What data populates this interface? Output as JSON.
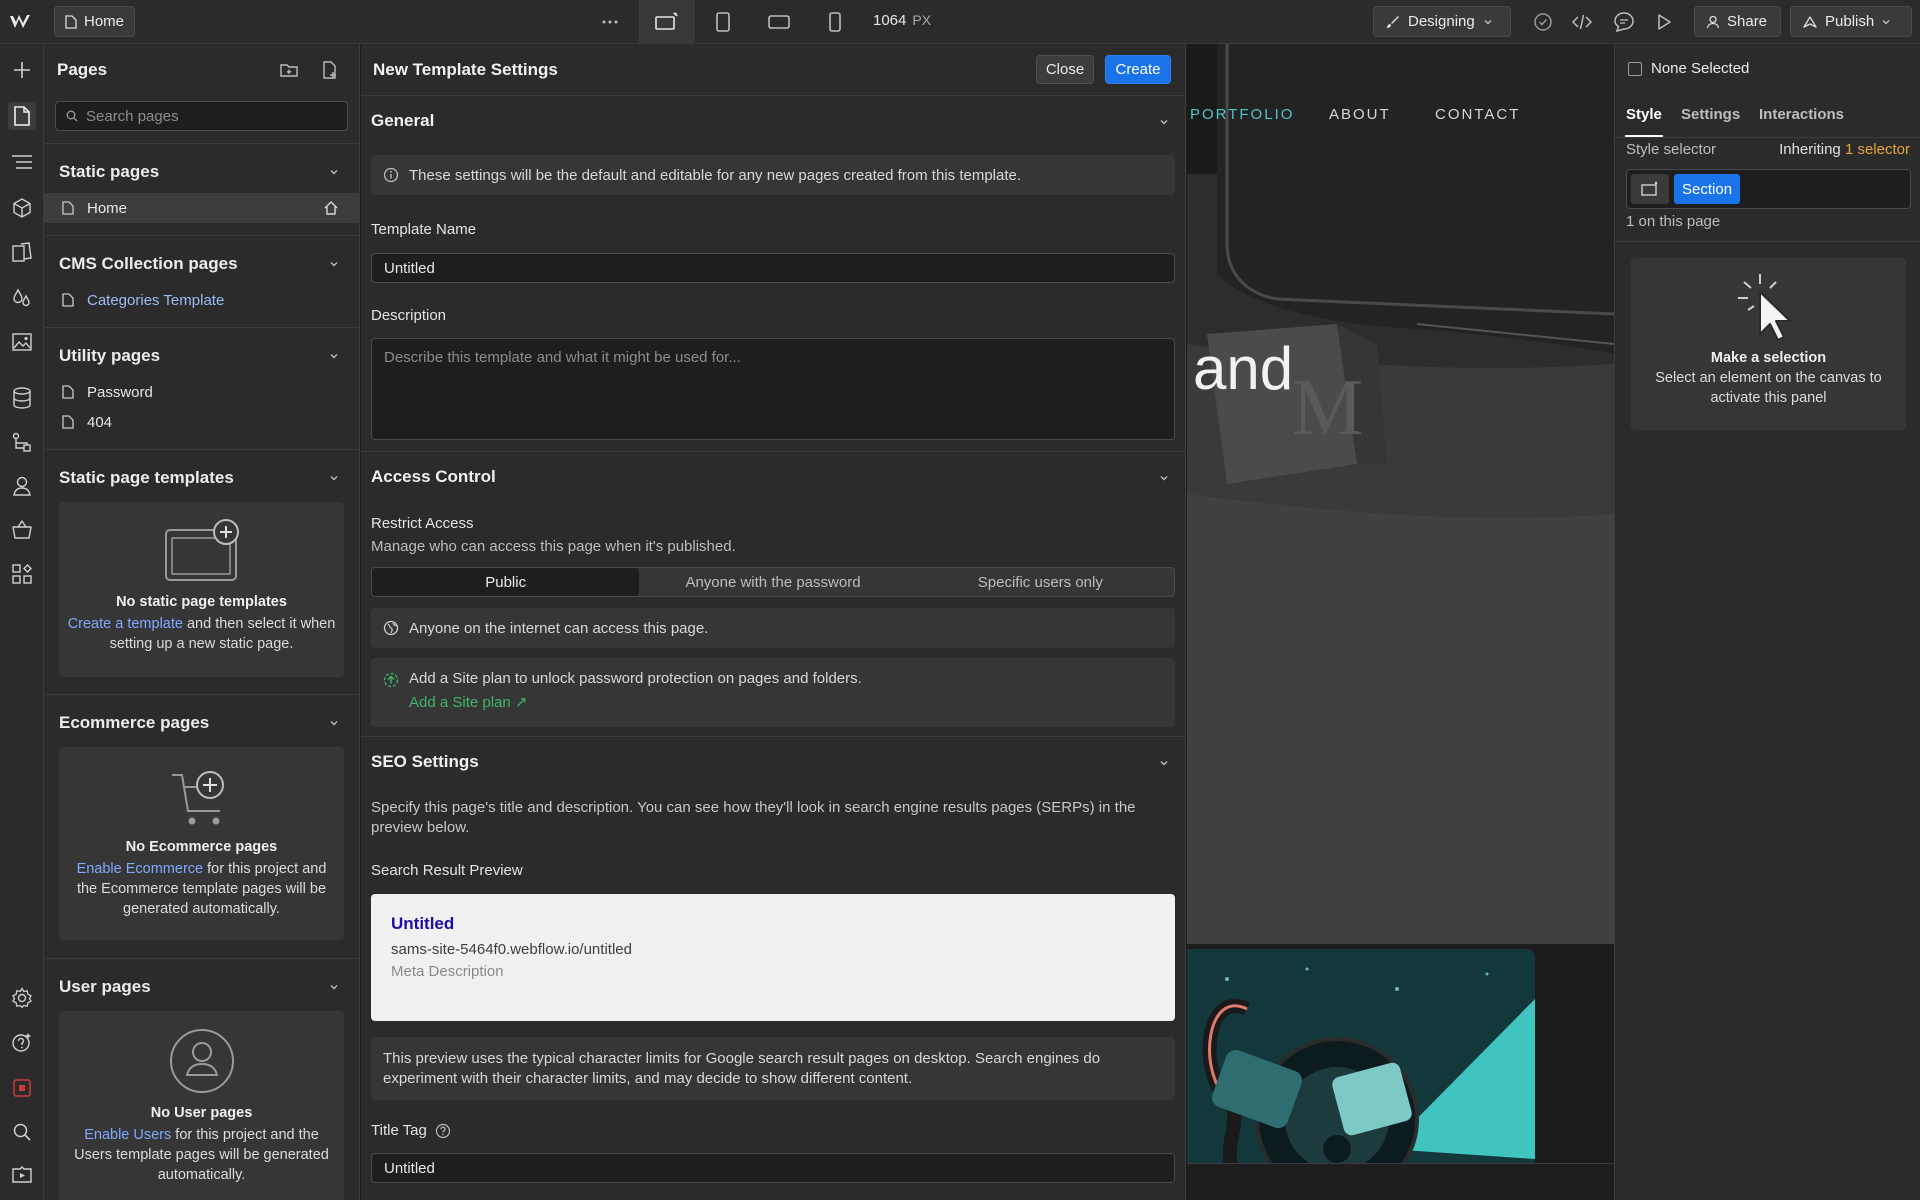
{
  "topbar": {
    "page_button": "Home",
    "width_value": "1064",
    "width_unit": "PX",
    "mode_label": "Designing",
    "share_label": "Share",
    "publish_label": "Publish"
  },
  "pages_panel": {
    "title": "Pages",
    "search_placeholder": "Search pages",
    "sections": {
      "static": {
        "title": "Static pages",
        "items": [
          "Home"
        ]
      },
      "cms": {
        "title": "CMS Collection pages",
        "items": [
          "Categories Template"
        ]
      },
      "utility": {
        "title": "Utility pages",
        "items": [
          "Password",
          "404"
        ]
      },
      "templates": {
        "title": "Static page templates",
        "empty_title": "No static page templates",
        "link": "Create a template",
        "text": " and then select it when setting up a new static page."
      },
      "ecommerce": {
        "title": "Ecommerce pages",
        "empty_title": "No Ecommerce pages",
        "link": "Enable Ecommerce",
        "text": " for this project and the Ecommerce template pages will be generated automatically."
      },
      "users": {
        "title": "User pages",
        "empty_title": "No User pages",
        "link": "Enable Users",
        "text": " for this project and the Users template pages will be generated automatically."
      }
    }
  },
  "template_settings": {
    "title": "New Template Settings",
    "close_label": "Close",
    "create_label": "Create",
    "general": {
      "title": "General",
      "info": "These settings will be the default and editable for any new pages created from this template.",
      "name_label": "Template Name",
      "name_value": "Untitled",
      "description_label": "Description",
      "description_placeholder": "Describe this template and what it might be used for..."
    },
    "access": {
      "title": "Access Control",
      "restrict_label": "Restrict Access",
      "restrict_sub": "Manage who can access this page when it's published.",
      "options": [
        "Public",
        "Anyone with the password",
        "Specific users only"
      ],
      "selected": "Public",
      "public_info": "Anyone on the internet can access this page.",
      "plan_info": "Add a Site plan to unlock password protection on pages and folders.",
      "plan_link": "Add a Site plan ↗"
    },
    "seo": {
      "title": "SEO Settings",
      "intro": "Specify this page's title and description. You can see how they'll look in search engine results pages (SERPs) in the preview below.",
      "preview_label": "Search Result Preview",
      "preview_title": "Untitled",
      "preview_url": "sams-site-5464f0.webflow.io/untitled",
      "preview_desc": "Meta Description",
      "note": "This preview uses the typical character limits for Google search result pages on desktop. Search engines do experiment with their character limits, and may decide to show different content.",
      "title_tag_label": "Title Tag",
      "title_tag_value": "Untitled"
    }
  },
  "canvas": {
    "nav": [
      "PORTFOLIO",
      "ABOUT",
      "CONTACT"
    ],
    "hero_word": "and",
    "accent_color": "#4fc3c8"
  },
  "style_panel": {
    "none_selected": "None Selected",
    "tabs": [
      "Style",
      "Settings",
      "Interactions"
    ],
    "style_selector_label": "Style selector",
    "inheriting_label": "Inheriting",
    "inheriting_count": "1 selector",
    "selector_chip": "Section",
    "on_page": "1 on this page",
    "empty_title": "Make a selection",
    "empty_text": "Select an element on the canvas to activate this panel"
  }
}
